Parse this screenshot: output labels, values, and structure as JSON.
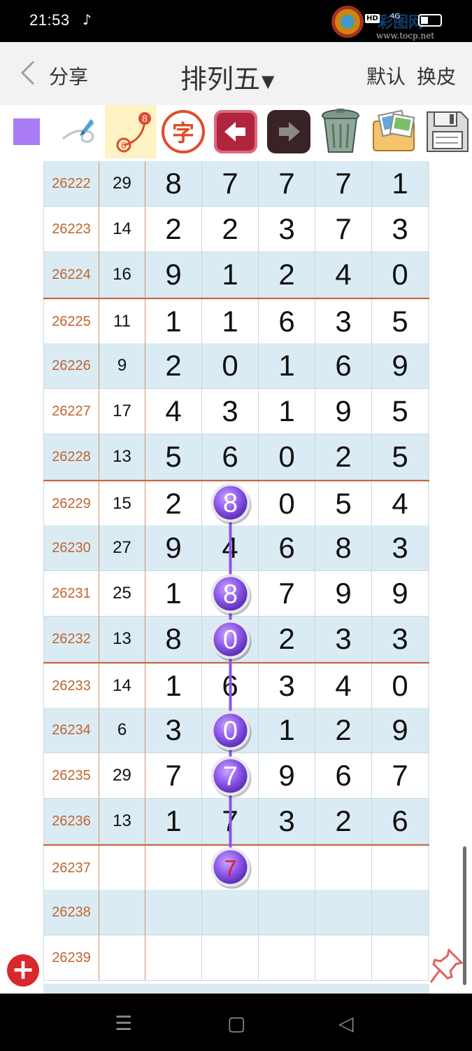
{
  "status_bar": {
    "time": "21:53",
    "hd": "HD",
    "network": "4G",
    "watermark_site": "www.tocp.net",
    "watermark_name": "彩图网"
  },
  "nav": {
    "share": "分享",
    "title": "排列五",
    "title_caret": "▼",
    "default": "默认",
    "skin": "换皮"
  },
  "toolbar": {
    "color_swatch": "#a97cf5",
    "path_icon_top": "8",
    "path_icon_bottom": "6",
    "char_icon": "字"
  },
  "table": {
    "rows": [
      {
        "issue": "26222",
        "sum": "29",
        "digits": [
          "8",
          "7",
          "7",
          "7",
          "1"
        ]
      },
      {
        "issue": "26223",
        "sum": "14",
        "digits": [
          "2",
          "2",
          "3",
          "7",
          "3"
        ]
      },
      {
        "issue": "26224",
        "sum": "16",
        "digits": [
          "9",
          "1",
          "2",
          "4",
          "0"
        ]
      },
      {
        "issue": "26225",
        "sum": "11",
        "digits": [
          "1",
          "1",
          "6",
          "3",
          "5"
        ]
      },
      {
        "issue": "26226",
        "sum": "9",
        "digits": [
          "2",
          "0",
          "1",
          "6",
          "9"
        ]
      },
      {
        "issue": "26227",
        "sum": "17",
        "digits": [
          "4",
          "3",
          "1",
          "9",
          "5"
        ]
      },
      {
        "issue": "26228",
        "sum": "13",
        "digits": [
          "5",
          "6",
          "0",
          "2",
          "5"
        ]
      },
      {
        "issue": "26229",
        "sum": "15",
        "digits": [
          "2",
          "8",
          "0",
          "5",
          "4"
        ]
      },
      {
        "issue": "26230",
        "sum": "27",
        "digits": [
          "9",
          "4",
          "6",
          "8",
          "3"
        ]
      },
      {
        "issue": "26231",
        "sum": "25",
        "digits": [
          "1",
          "8",
          "7",
          "9",
          "9"
        ]
      },
      {
        "issue": "26232",
        "sum": "13",
        "digits": [
          "8",
          "0",
          "2",
          "3",
          "3"
        ]
      },
      {
        "issue": "26233",
        "sum": "14",
        "digits": [
          "1",
          "6",
          "3",
          "4",
          "0"
        ]
      },
      {
        "issue": "26234",
        "sum": "6",
        "digits": [
          "3",
          "0",
          "1",
          "2",
          "9"
        ]
      },
      {
        "issue": "26235",
        "sum": "29",
        "digits": [
          "7",
          "7",
          "9",
          "6",
          "7"
        ]
      },
      {
        "issue": "26236",
        "sum": "13",
        "digits": [
          "1",
          "7",
          "3",
          "2",
          "6"
        ]
      },
      {
        "issue": "26237",
        "sum": "",
        "digits": [
          "",
          "",
          "",
          "",
          ""
        ]
      },
      {
        "issue": "26238",
        "sum": "",
        "digits": [
          "",
          "",
          "",
          "",
          ""
        ]
      },
      {
        "issue": "26239",
        "sum": "",
        "digits": [
          "",
          "",
          "",
          "",
          ""
        ]
      }
    ],
    "marked_column": 1,
    "marked_rows": [
      7,
      9,
      10,
      12,
      13
    ],
    "predicted_row": 15,
    "predicted_value": "7",
    "marker_color": "#8b55e8",
    "predicted_color": "#e02020"
  },
  "side": {
    "add_icon": "+"
  },
  "system_nav": {
    "menu": "☰",
    "home": "▢",
    "back": "◁"
  }
}
